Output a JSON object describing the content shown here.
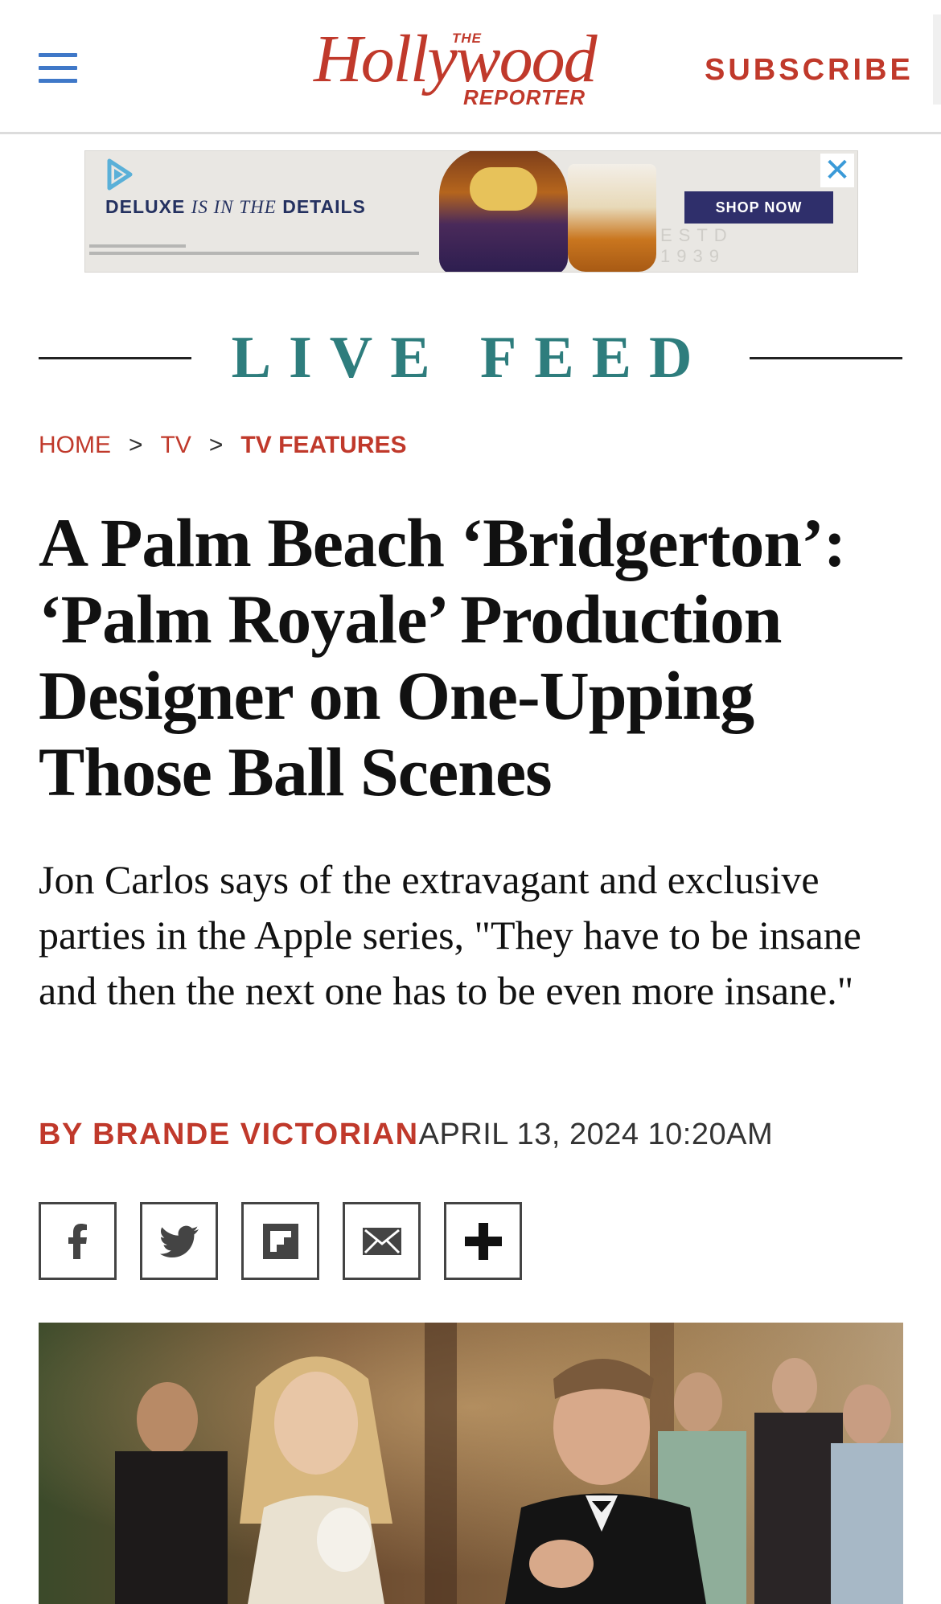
{
  "header": {
    "logo": {
      "the": "THE",
      "main": "Hollywood",
      "reporter": "REPORTER"
    },
    "subscribe_label": "SUBSCRIBE",
    "menu_icon": "hamburger-menu-icon"
  },
  "ad": {
    "headline_a": "DELUXE ",
    "headline_b": "IS IN THE",
    "headline_c": " DETAILS",
    "cta": "SHOP NOW",
    "estd": "ESTD",
    "year": "1939",
    "close_icon": "close-icon"
  },
  "section": {
    "label": "LIVE FEED",
    "color": "#2e7d7d"
  },
  "breadcrumb": {
    "items": [
      "HOME",
      "TV",
      "TV FEATURES"
    ],
    "separator": ">"
  },
  "article": {
    "headline": "A Palm Beach ‘Bridgerton’: ‘Palm Royale’ Production Designer on One-Upping Those Ball Scenes",
    "dek": "Jon Carlos says of the extravagant and exclusive parties in the Apple series, \"They have to be insane and then the next one has to be even more insane.\"",
    "byline": "BY BRANDE VICTORIAN",
    "date": "APRIL 13, 2024 10:20AM"
  },
  "share": {
    "buttons": [
      "facebook-icon",
      "twitter-icon",
      "flipboard-icon",
      "email-icon",
      "plus-icon"
    ]
  },
  "colors": {
    "brand_red": "#c0392b",
    "menu_blue": "#3f78c8",
    "teal": "#2e7d7d"
  }
}
